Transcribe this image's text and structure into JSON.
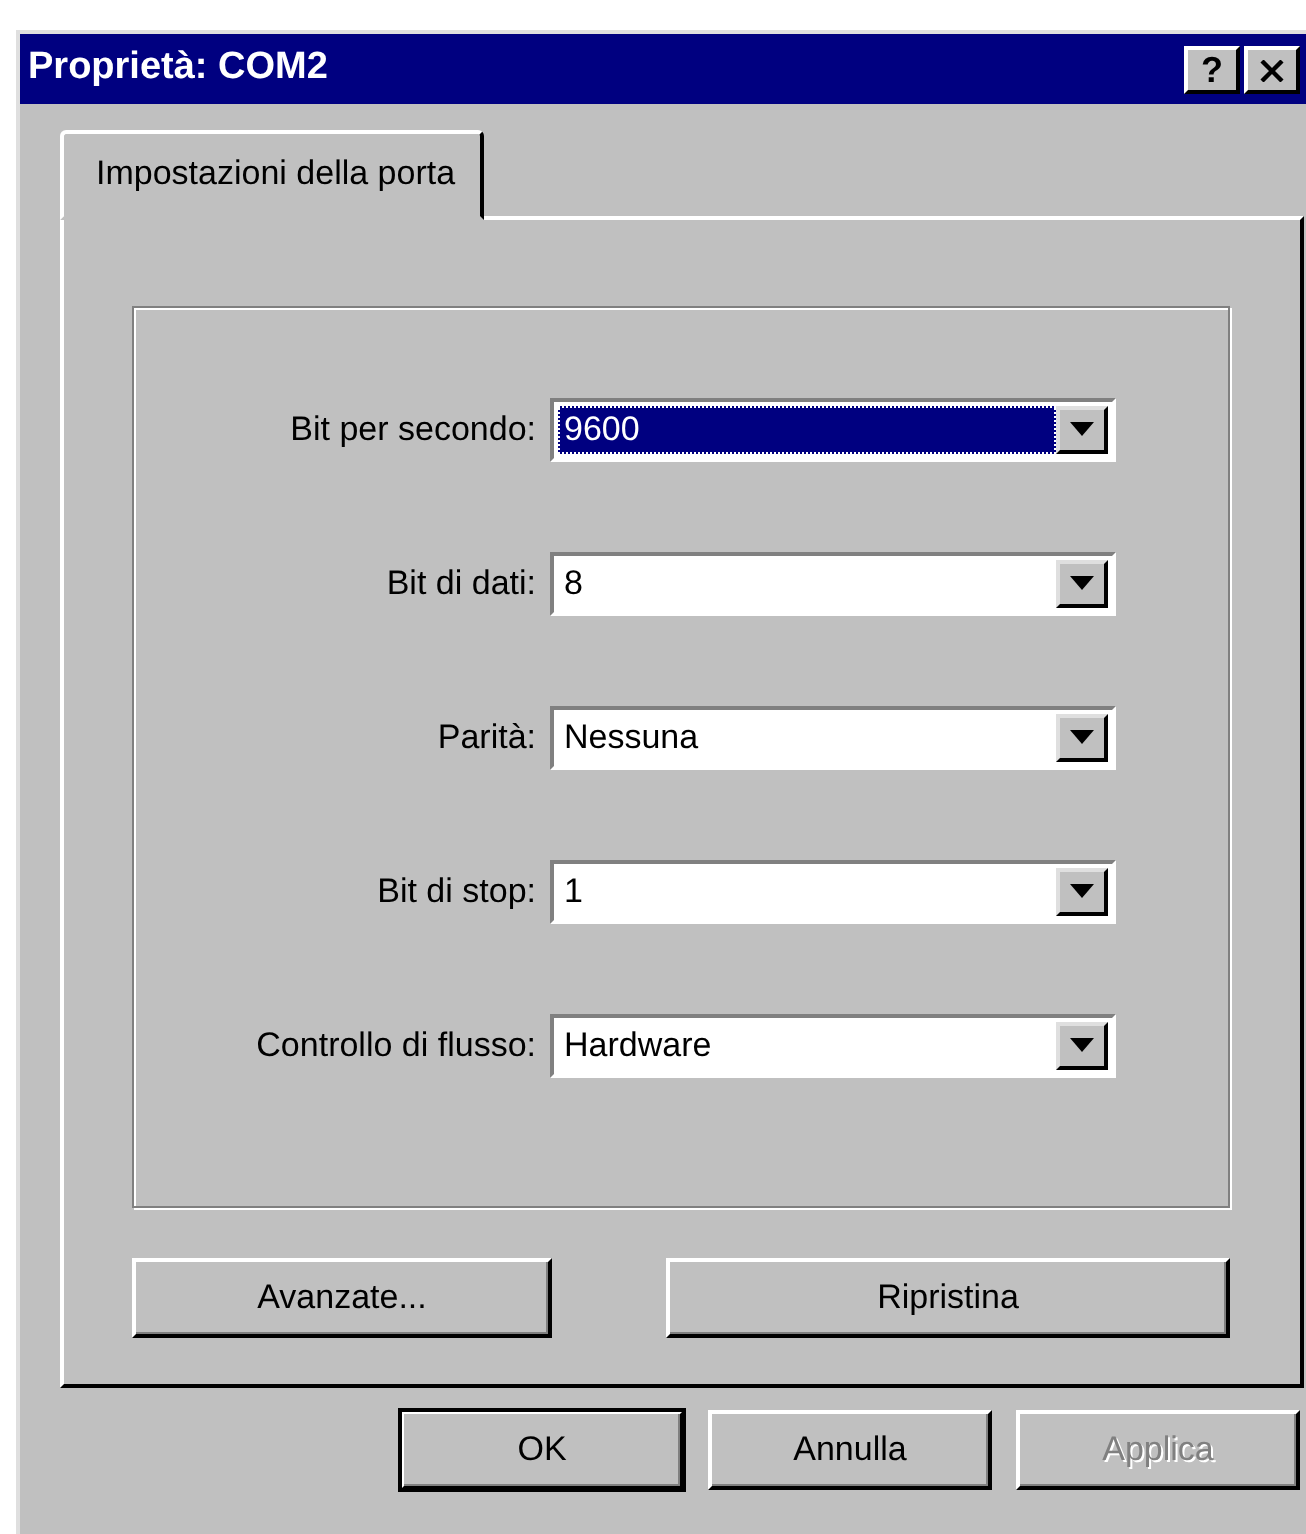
{
  "window": {
    "title": "Proprietà: COM2",
    "title_buttons": [
      {
        "kind": "help",
        "label": "?"
      },
      {
        "kind": "close"
      }
    ]
  },
  "tabs": [
    {
      "label": "Impostazioni della porta",
      "selected": true
    }
  ],
  "fields": [
    {
      "label": "Bit per secondo:",
      "value": "9600",
      "selected": true
    },
    {
      "label": "Bit di dati:",
      "value": "8",
      "selected": false
    },
    {
      "label": "Parità:",
      "value": "Nessuna",
      "selected": false
    },
    {
      "label": "Bit di stop:",
      "value": "1",
      "selected": false
    },
    {
      "label": "Controllo di flusso:",
      "value": "Hardware",
      "selected": false
    }
  ],
  "panel_buttons": [
    {
      "label": "Avanzate..."
    },
    {
      "label": "Ripristina"
    }
  ],
  "dialog_buttons": [
    {
      "label": "OK",
      "default": true,
      "disabled": false
    },
    {
      "label": "Annulla",
      "disabled": false,
      "default": false
    },
    {
      "label": "Applica",
      "disabled": true,
      "default": false
    }
  ]
}
